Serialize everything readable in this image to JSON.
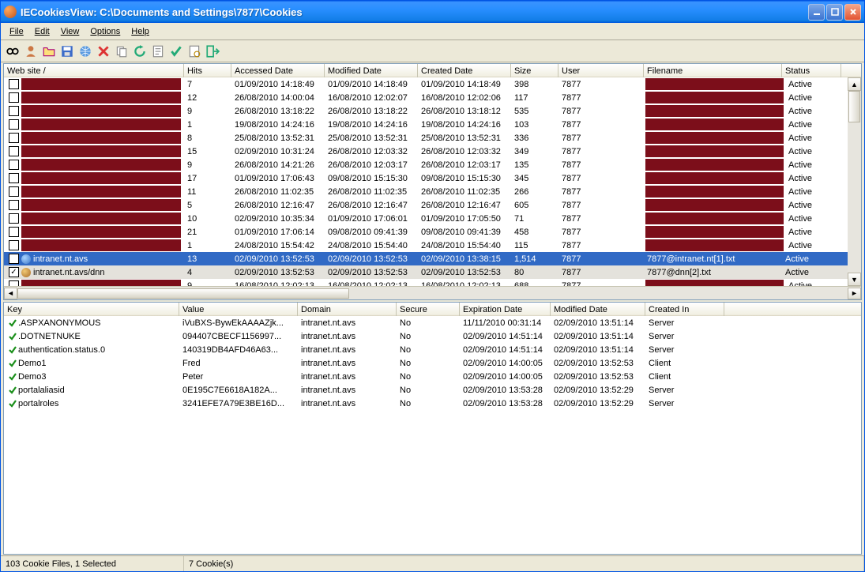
{
  "title": "IECookiesView:   C:\\Documents and Settings\\7877\\Cookies",
  "menus": [
    "File",
    "Edit",
    "View",
    "Options",
    "Help"
  ],
  "top_headers": [
    "Web site  /",
    "Hits",
    "Accessed Date",
    "Modified Date",
    "Created Date",
    "Size",
    "User",
    "Filename",
    "Status"
  ],
  "top_rows": [
    {
      "chk": false,
      "site": "",
      "hits": "7",
      "acc": "01/09/2010 14:18:49",
      "mod": "01/09/2010 14:18:49",
      "cre": "01/09/2010 14:18:49",
      "size": "398",
      "user": "7877",
      "fn": "",
      "status": "Active",
      "redact": true
    },
    {
      "chk": false,
      "site": "",
      "hits": "12",
      "acc": "26/08/2010 14:00:04",
      "mod": "16/08/2010 12:02:07",
      "cre": "16/08/2010 12:02:06",
      "size": "117",
      "user": "7877",
      "fn": "",
      "status": "Active",
      "redact": true
    },
    {
      "chk": false,
      "site": "",
      "hits": "9",
      "acc": "26/08/2010 13:18:22",
      "mod": "26/08/2010 13:18:22",
      "cre": "26/08/2010 13:18:12",
      "size": "535",
      "user": "7877",
      "fn": "",
      "status": "Active",
      "redact": true
    },
    {
      "chk": false,
      "site": "",
      "hits": "1",
      "acc": "19/08/2010 14:24:16",
      "mod": "19/08/2010 14:24:16",
      "cre": "19/08/2010 14:24:16",
      "size": "103",
      "user": "7877",
      "fn": "",
      "status": "Active",
      "redact": true
    },
    {
      "chk": false,
      "site": "",
      "hits": "8",
      "acc": "25/08/2010 13:52:31",
      "mod": "25/08/2010 13:52:31",
      "cre": "25/08/2010 13:52:31",
      "size": "336",
      "user": "7877",
      "fn": "",
      "status": "Active",
      "redact": true
    },
    {
      "chk": false,
      "site": "",
      "hits": "15",
      "acc": "02/09/2010 10:31:24",
      "mod": "26/08/2010 12:03:32",
      "cre": "26/08/2010 12:03:32",
      "size": "349",
      "user": "7877",
      "fn": "",
      "status": "Active",
      "redact": true
    },
    {
      "chk": false,
      "site": "",
      "hits": "9",
      "acc": "26/08/2010 14:21:26",
      "mod": "26/08/2010 12:03:17",
      "cre": "26/08/2010 12:03:17",
      "size": "135",
      "user": "7877",
      "fn": "",
      "status": "Active",
      "redact": true
    },
    {
      "chk": false,
      "site": "",
      "hits": "17",
      "acc": "01/09/2010 17:06:43",
      "mod": "09/08/2010 15:15:30",
      "cre": "09/08/2010 15:15:30",
      "size": "345",
      "user": "7877",
      "fn": "",
      "status": "Active",
      "redact": true
    },
    {
      "chk": false,
      "site": "",
      "hits": "11",
      "acc": "26/08/2010 11:02:35",
      "mod": "26/08/2010 11:02:35",
      "cre": "26/08/2010 11:02:35",
      "size": "266",
      "user": "7877",
      "fn": "",
      "status": "Active",
      "redact": true
    },
    {
      "chk": false,
      "site": "",
      "hits": "5",
      "acc": "26/08/2010 12:16:47",
      "mod": "26/08/2010 12:16:47",
      "cre": "26/08/2010 12:16:47",
      "size": "605",
      "user": "7877",
      "fn": "",
      "status": "Active",
      "redact": true
    },
    {
      "chk": false,
      "site": "",
      "hits": "10",
      "acc": "02/09/2010 10:35:34",
      "mod": "01/09/2010 17:06:01",
      "cre": "01/09/2010 17:05:50",
      "size": "71",
      "user": "7877",
      "fn": "",
      "status": "Active",
      "redact": true
    },
    {
      "chk": false,
      "site": "",
      "hits": "21",
      "acc": "01/09/2010 17:06:14",
      "mod": "09/08/2010 09:41:39",
      "cre": "09/08/2010 09:41:39",
      "size": "458",
      "user": "7877",
      "fn": "",
      "status": "Active",
      "redact": true
    },
    {
      "chk": false,
      "site": "",
      "hits": "1",
      "acc": "24/08/2010 15:54:42",
      "mod": "24/08/2010 15:54:40",
      "cre": "24/08/2010 15:54:40",
      "size": "115",
      "user": "7877",
      "fn": "",
      "status": "Active",
      "redact": true
    },
    {
      "chk": false,
      "site": "intranet.nt.avs",
      "hits": "13",
      "acc": "02/09/2010 13:52:53",
      "mod": "02/09/2010 13:52:53",
      "cre": "02/09/2010 13:38:15",
      "size": "1,514",
      "user": "7877",
      "fn": "7877@intranet.nt[1].txt",
      "status": "Active",
      "selected": true,
      "icon": "globe"
    },
    {
      "chk": true,
      "site": "intranet.nt.avs/dnn",
      "hits": "4",
      "acc": "02/09/2010 13:52:53",
      "mod": "02/09/2010 13:52:53",
      "cre": "02/09/2010 13:52:53",
      "size": "80",
      "user": "7877",
      "fn": "7877@dnn[2].txt",
      "status": "Active",
      "checked_row": true,
      "icon": "cookie"
    },
    {
      "chk": false,
      "site": "",
      "hits": "9",
      "acc": "16/08/2010 12:02:13",
      "mod": "16/08/2010 12:02:13",
      "cre": "16/08/2010 12:02:13",
      "size": "688",
      "user": "7877",
      "fn": "",
      "status": "Active",
      "redact": true
    }
  ],
  "bottom_headers": [
    "Key",
    "Value",
    "Domain",
    "Secure",
    "Expiration Date",
    "Modified Date",
    "Created In"
  ],
  "bottom_rows": [
    {
      "key": ".ASPXANONYMOUS",
      "val": "iVuBXS-BywEkAAAAZjk...",
      "dom": "intranet.nt.avs",
      "sec": "No",
      "exp": "11/11/2010 00:31:14",
      "mod": "02/09/2010 13:51:14",
      "cin": "Server"
    },
    {
      "key": ".DOTNETNUKE",
      "val": "094407CBECF1156997...",
      "dom": "intranet.nt.avs",
      "sec": "No",
      "exp": "02/09/2010 14:51:14",
      "mod": "02/09/2010 13:51:14",
      "cin": "Server"
    },
    {
      "key": "authentication.status.0",
      "val": "140319DB4AFD46A63...",
      "dom": "intranet.nt.avs",
      "sec": "No",
      "exp": "02/09/2010 14:51:14",
      "mod": "02/09/2010 13:51:14",
      "cin": "Server"
    },
    {
      "key": "Demo1",
      "val": "Fred",
      "dom": "intranet.nt.avs",
      "sec": "No",
      "exp": "02/09/2010 14:00:05",
      "mod": "02/09/2010 13:52:53",
      "cin": "Client"
    },
    {
      "key": "Demo3",
      "val": "Peter",
      "dom": "intranet.nt.avs",
      "sec": "No",
      "exp": "02/09/2010 14:00:05",
      "mod": "02/09/2010 13:52:53",
      "cin": "Client"
    },
    {
      "key": "portalaliasid",
      "val": "0E195C7E6618A182A...",
      "dom": "intranet.nt.avs",
      "sec": "No",
      "exp": "02/09/2010 13:53:28",
      "mod": "02/09/2010 13:52:29",
      "cin": "Server"
    },
    {
      "key": "portalroles",
      "val": "3241EFE7A79E3BE16D...",
      "dom": "intranet.nt.avs",
      "sec": "No",
      "exp": "02/09/2010 13:53:28",
      "mod": "02/09/2010 13:52:29",
      "cin": "Server"
    }
  ],
  "status": {
    "left": "103 Cookie Files, 1 Selected",
    "right": "7 Cookie(s)"
  }
}
